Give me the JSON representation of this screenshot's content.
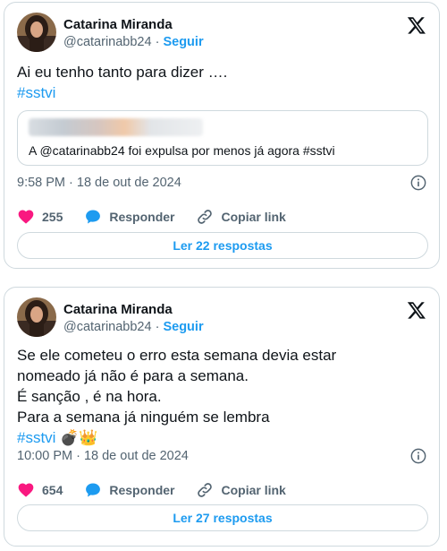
{
  "tweets": [
    {
      "author_name": "Catarina Miranda",
      "handle": "@catarinabb24",
      "separator": "·",
      "follow_label": "Seguir",
      "text_lines": [
        "Ai eu tenho tanto para dizer …."
      ],
      "hashtag": "#sstvi",
      "emojis": "",
      "quote_text": "A @catarinabb24 foi expulsa por menos já agora #sstvi",
      "timestamp": "9:58 PM · 18 de out de 2024",
      "likes": "255",
      "reply_label": "Responder",
      "copy_link_label": "Copiar link",
      "read_replies_label": "Ler 22 respostas"
    },
    {
      "author_name": "Catarina Miranda",
      "handle": "@catarinabb24",
      "separator": "·",
      "follow_label": "Seguir",
      "text_lines": [
        "Se ele cometeu o erro esta semana devia estar",
        "nomeado já não é para a semana.",
        "É sanção , é na hora.",
        "Para a semana já ninguém se lembra"
      ],
      "hashtag": "#sstvi",
      "emojis": "💣👑",
      "timestamp": "10:00 PM · 18 de out de 2024",
      "likes": "654",
      "reply_label": "Responder",
      "copy_link_label": "Copiar link",
      "read_replies_label": "Ler 27 respostas"
    }
  ],
  "icons": {
    "platform": "x-logo-icon",
    "like": "heart-icon",
    "reply": "speech-bubble-icon",
    "copy": "link-icon",
    "info": "info-icon"
  },
  "colors": {
    "accent": "#1d9bf0",
    "like": "#f91880",
    "secondary_text": "#536471",
    "border": "#cfd9de"
  }
}
